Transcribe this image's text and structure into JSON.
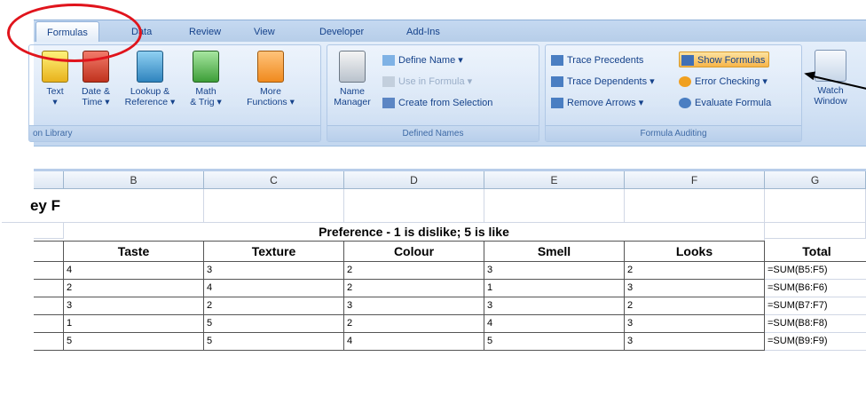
{
  "ribbon": {
    "tabs": [
      "Formulas",
      "Data",
      "Review",
      "View",
      "Developer",
      "Add-Ins"
    ],
    "active_tab": "Formulas",
    "function_library": {
      "buttons": [
        {
          "label1": "Text",
          "label2": "▾"
        },
        {
          "label1": "Date &",
          "label2": "Time ▾"
        },
        {
          "label1": "Lookup &",
          "label2": "Reference ▾"
        },
        {
          "label1": "Math",
          "label2": "& Trig ▾"
        },
        {
          "label1": "More",
          "label2": "Functions ▾"
        }
      ],
      "group_label": "on Library"
    },
    "defined_names": {
      "name_manager1": "Name",
      "name_manager2": "Manager",
      "define_name": "Define Name ▾",
      "use_in_formula": "Use in Formula ▾",
      "create_from_selection": "Create from Selection",
      "group_label": "Defined Names"
    },
    "formula_auditing": {
      "trace_precedents": "Trace Precedents",
      "trace_dependents": "Trace Dependents ▾",
      "remove_arrows": "Remove Arrows ▾",
      "show_formulas": "Show Formulas",
      "error_checking": "Error Checking ▾",
      "evaluate_formula": "Evaluate Formula",
      "group_label": "Formula Auditing"
    },
    "watch_window1": "Watch",
    "watch_window2": "Window"
  },
  "sheet": {
    "columns": [
      "B",
      "C",
      "D",
      "E",
      "F",
      "G"
    ],
    "title_fragment": "ey F",
    "merged_header": "Preference - 1 is dislike; 5 is like",
    "headers": [
      "Taste",
      "Texture",
      "Colour",
      "Smell",
      "Looks",
      "Total"
    ],
    "rows": [
      [
        "4",
        "3",
        "2",
        "3",
        "2",
        "=SUM(B5:F5)"
      ],
      [
        "2",
        "4",
        "2",
        "1",
        "3",
        "=SUM(B6:F6)"
      ],
      [
        "3",
        "2",
        "3",
        "3",
        "2",
        "=SUM(B7:F7)"
      ],
      [
        "1",
        "5",
        "2",
        "4",
        "3",
        "=SUM(B8:F8)"
      ],
      [
        "5",
        "5",
        "4",
        "5",
        "3",
        "=SUM(B9:F9)"
      ]
    ]
  },
  "colors": {
    "annotation_oval": "#e0141c",
    "ribbon_text": "#15428b",
    "show_formulas_highlight": "#f7b54a"
  }
}
